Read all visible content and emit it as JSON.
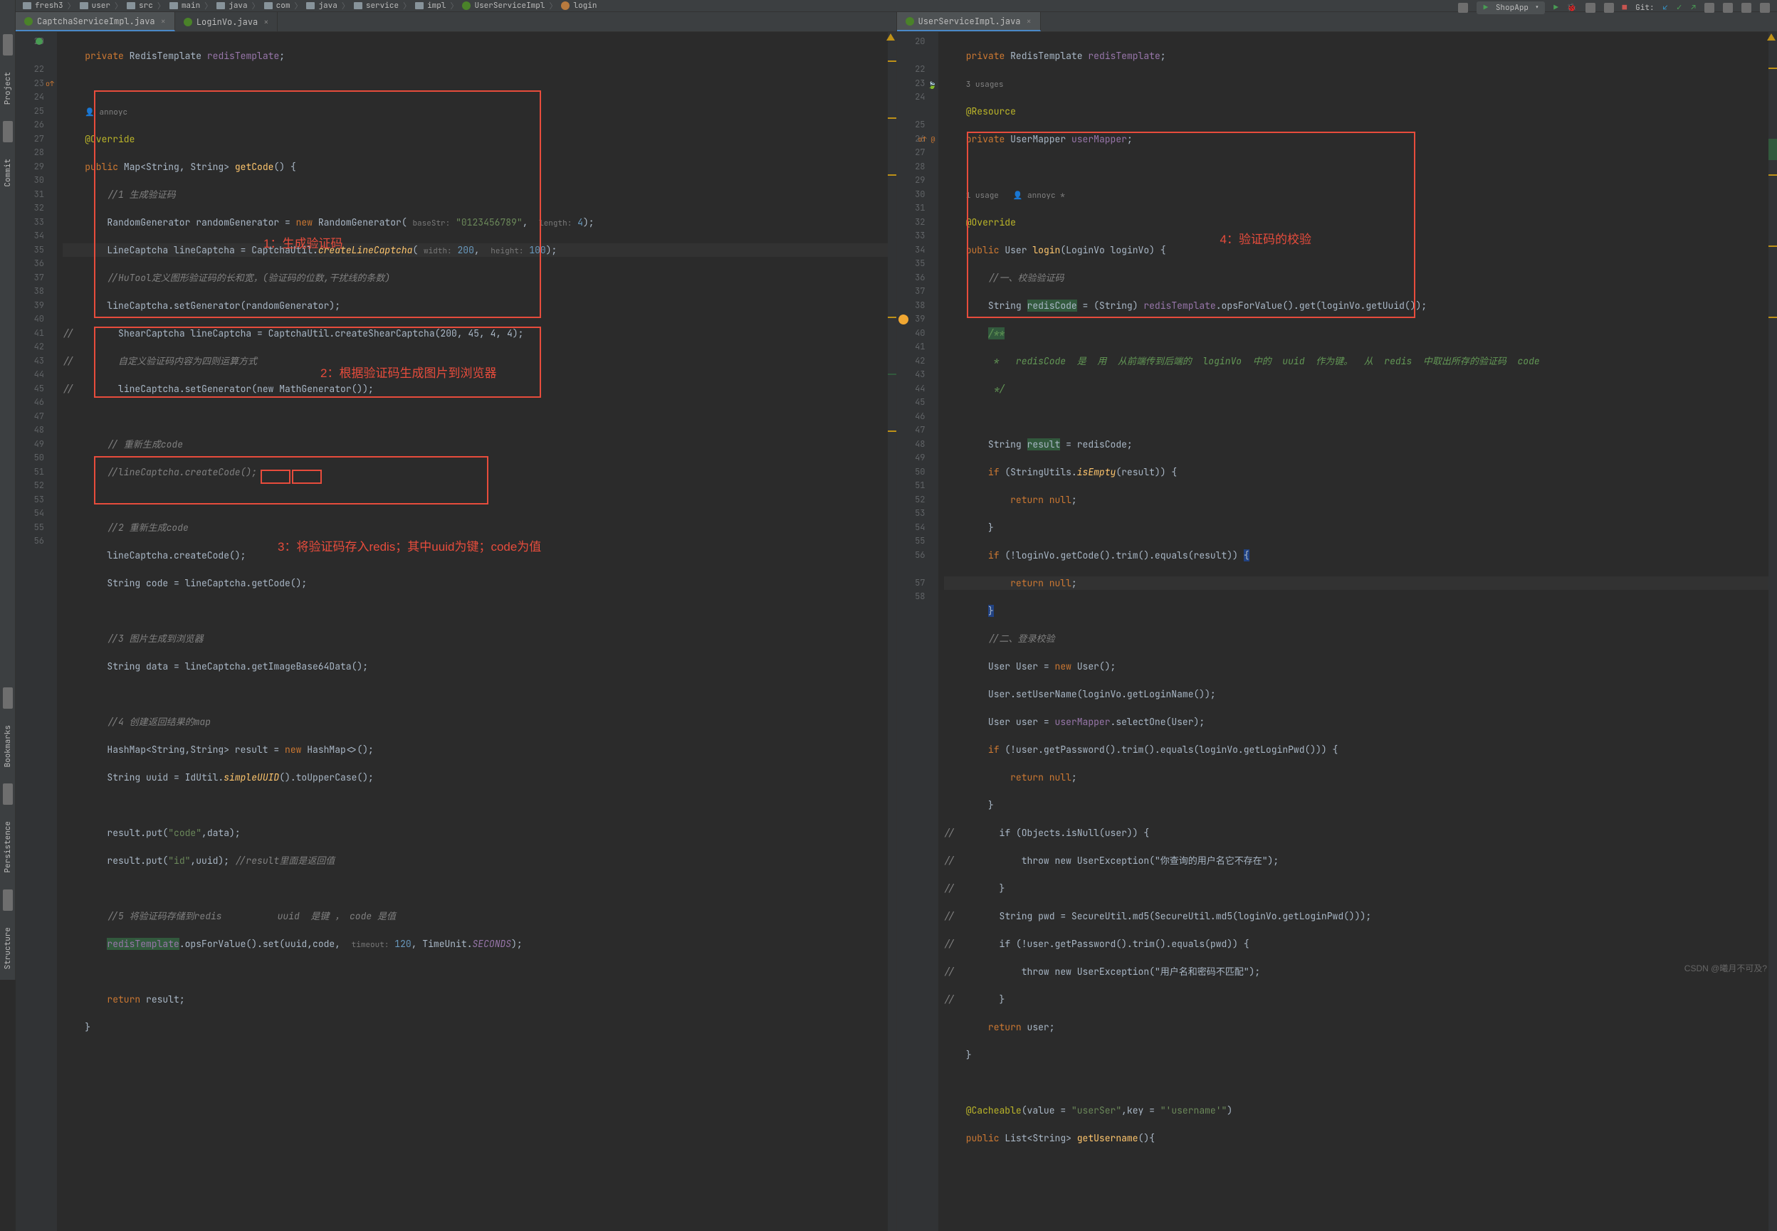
{
  "breadcrumb": [
    "fresh3",
    "user",
    "src",
    "main",
    "java",
    "com",
    "java",
    "service",
    "impl"
  ],
  "breadcrumb_class": "UserServiceImpl",
  "breadcrumb_method": "login",
  "toolbar": {
    "run_config": "ShopApp",
    "git_label": "Git:"
  },
  "sidebar": [
    "Project",
    "Commit",
    "Bookmarks",
    "Persistence",
    "Structure"
  ],
  "tabs_left": [
    {
      "label": "CaptchaServiceImpl.java",
      "active": true
    },
    {
      "label": "LoginVo.java",
      "active": false
    }
  ],
  "tabs_right": [
    {
      "label": "UserServiceImpl.java",
      "active": true
    }
  ],
  "annotations": {
    "box1": "1：生成验证码",
    "box2": "2：根据验证码生成图片到浏览器",
    "box3": "3：将验证码存入redis；其中uuid为键；code为值",
    "box4": "4：验证码的校验"
  },
  "author": "annoyc",
  "usages_3": "3 usages",
  "usage_1": "1 usage",
  "watermark": "CSDN @曦月不可及?",
  "left_code": {
    "l20": {
      "a": "private",
      "b": "RedisTemplate",
      "c": "redisTemplate",
      "d": ";"
    },
    "l22_author": "annoyc",
    "l23": "@Override",
    "l24": {
      "a": "public",
      "b": "Map<String, String>",
      "c": "getCode",
      "d": "() {"
    },
    "l25": "//1 生成验证码",
    "l26": {
      "a": "RandomGenerator randomGenerator = ",
      "b": "new",
      "c": "RandomGenerator(",
      "h1": "baseStr:",
      "s": "\"0123456789\"",
      "d": ", ",
      "h2": "length:",
      "n": "4",
      "e": ");"
    },
    "l27": {
      "a": "LineCaptcha lineCaptcha = CaptchaUtil.",
      "m": "createLineCaptcha",
      "b": "(",
      "h1": "width:",
      "n1": "200",
      "c": ", ",
      "h2": "height:",
      "n2": "100",
      "d": ");"
    },
    "l28": "//HuTool定义图形验证码的长和宽，(验证码的位数,干扰线的条数)",
    "l29": "lineCaptcha.setGenerator(randomGenerator);",
    "l30": {
      "c": "//",
      "a": "    ShearCaptcha lineCaptcha = CaptchaUtil.createShearCaptcha(200, 45, 4, 4);"
    },
    "l31": {
      "c": "//",
      "a": "    自定义验证码内容为四则运算方式"
    },
    "l32": {
      "c": "//",
      "a": "    lineCaptcha.setGenerator(new MathGenerator());"
    },
    "l34": "// 重新生成code",
    "l35": "//lineCaptcha.createCode();",
    "l37": "//2 重新生成code",
    "l38": "lineCaptcha.createCode();",
    "l39": {
      "a": "String code = lineCaptcha.getCode();"
    },
    "l41": "//3 图片生成到浏览器",
    "l42": "String data = lineCaptcha.getImageBase64Data();",
    "l44": "//4 创建返回结果的map",
    "l45": {
      "a": "HashMap<String,String> result = ",
      "b": "new",
      "c": " HashMap<>();"
    },
    "l46": {
      "a": "String uuid = IdUtil.",
      "m": "simpleUUID",
      "b": "().toUpperCase();"
    },
    "l48": {
      "a": "result.put(",
      "s": "\"code\"",
      "b": ",data);"
    },
    "l49": {
      "a": "result.put(",
      "s": "\"id\"",
      "b": ",uuid); ",
      "c": "//result里面是返回值"
    },
    "l51": {
      "a": "//5 将验证码存储到redis          uuid  是键 ， code 是值"
    },
    "l52": {
      "f": "redisTemplate",
      "a": ".opsForValue().set(",
      "u": "uuid",
      "b": ",",
      "code": "code",
      "c": ", ",
      "h": "timeout:",
      "n": "120",
      "d": ", TimeUnit.",
      "e": "SECONDS",
      "g": ");"
    },
    "l54": {
      "a": "return",
      "b": " result;"
    },
    "l55": "}"
  },
  "right_code": {
    "l20": {
      "a": "private",
      "b": "RedisTemplate",
      "c": "redisTemplate",
      "d": ";"
    },
    "l21_usages": "3 usages",
    "l22": "@Resource",
    "l23": {
      "a": "private",
      "b": "UserMapper",
      "c": "userMapper",
      "d": ";"
    },
    "l25_usage": "1 usage   annoyc *",
    "l26": "@Override",
    "l27": {
      "a": "public",
      "b": "User",
      "c": "login",
      "d": "(LoginVo loginVo) {"
    },
    "l28": "//一、校验验证码",
    "l29": {
      "a": "String ",
      "hl": "redisCode",
      "b": " = (String) ",
      "f": "redisTemplate",
      "c": ".opsForValue().get(loginVo.getUuid());"
    },
    "l30": "/**",
    "l31": " *   redisCode  是  用  从前端传到后端的  loginVo  中的  uuid  作为键。  从  redis  中取出所存的验证码  code",
    "l32": " */",
    "l34": {
      "a": "String ",
      "hl": "result",
      "b": " = redisCode;"
    },
    "l35": {
      "a": "if",
      "b": " (StringUtils.",
      "m": "isEmpty",
      "c": "(result)) {"
    },
    "l36": {
      "a": "return null",
      "b": ";"
    },
    "l37": "}",
    "l38": {
      "a": "if",
      "b": " (!loginVo.getCode().trim().equals(result)) ",
      "br": "{"
    },
    "l39": {
      "a": "return null",
      "b": ";"
    },
    "l40": {
      "br": "}"
    },
    "l41": "//二、登录校验",
    "l42": {
      "a": "User User = ",
      "b": "new",
      "c": " User();"
    },
    "l43": "User.setUserName(loginVo.getLoginName());",
    "l44": {
      "a": "User user = ",
      "f": "userMapper",
      "b": ".selectOne(User);"
    },
    "l45": {
      "a": "if",
      "b": " (!user.getPassword().trim().equals(loginVo.getLoginPwd())) {"
    },
    "l46": {
      "a": "return null",
      "b": ";"
    },
    "l47": "}",
    "l48": {
      "c": "//",
      "a": "    if (Objects.isNull(user)) {"
    },
    "l49": {
      "c": "//",
      "a": "        throw new UserException(\"你查询的用户名它不存在\");"
    },
    "l50": {
      "c": "//",
      "a": "    }"
    },
    "l51": {
      "c": "//",
      "a": "    String pwd = SecureUtil.md5(SecureUtil.md5(loginVo.getLoginPwd()));"
    },
    "l52": {
      "c": "//",
      "a": "    if (!user.getPassword().trim().equals(pwd)) {"
    },
    "l53": {
      "c": "//",
      "a": "        throw new UserException(\"用户名和密码不匹配\");"
    },
    "l54": {
      "c": "//",
      "a": "    }"
    },
    "l55": {
      "a": "return",
      "b": " user;"
    },
    "l56": "}",
    "l58": {
      "a": "@Cacheable",
      "b": "(value = ",
      "s1": "\"userSer\"",
      "c": ",key = ",
      "s2": "\"'username'\"",
      "d": ")"
    },
    "l59": {
      "a": "public",
      "b": " List<String> ",
      "c": "getUsername",
      "d": "(){"
    }
  }
}
